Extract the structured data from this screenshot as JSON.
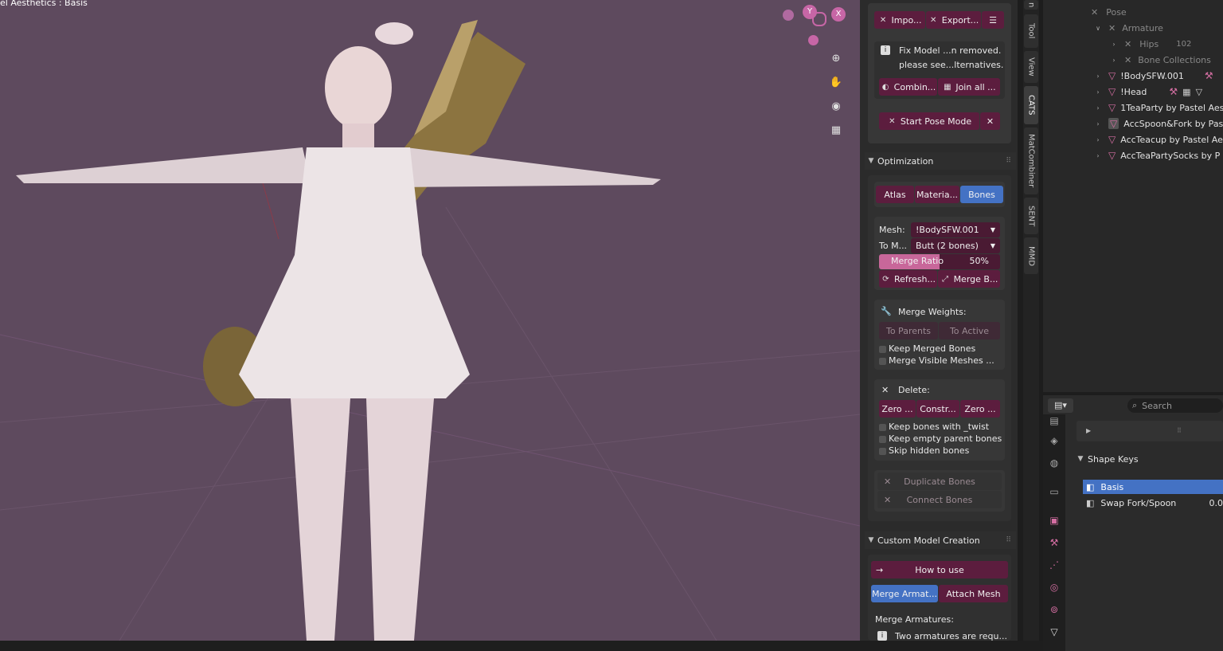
{
  "viewport": {
    "title": "el Aesthetics : Basis",
    "gizmo": {
      "y": "Y",
      "x": "X"
    },
    "icons": [
      "zoom-icon",
      "hand-icon",
      "camera-icon",
      "grid-icon"
    ]
  },
  "sidetabs": [
    "n",
    "Tool",
    "View",
    "CATS",
    "MatCombiner",
    "SENT",
    "MMD"
  ],
  "cats": {
    "import_label": "Impo...",
    "export_label": "Export...",
    "fix_model_line1": "Fix Model ...n removed.",
    "fix_model_line2": "please see...lternatives.",
    "combine_label": "Combin...",
    "join_label": "Join all ...",
    "start_pose_label": "Start Pose Mode"
  },
  "optimization": {
    "header": "Optimization",
    "tabs": [
      "Atlas",
      "Materia...",
      "Bones"
    ],
    "mesh_label": "Mesh:",
    "mesh_value": "!BodySFW.001",
    "to_merge_label": "To M...",
    "to_merge_value": "Butt (2 bones)",
    "merge_ratio_label": "Merge Ratio",
    "merge_ratio_value": "50%",
    "merge_ratio_fraction": 0.5,
    "refresh_label": "Refresh...",
    "merge_bones_label": "Merge B...",
    "merge_weights_label": "Merge Weights:",
    "to_parents_label": "To Parents",
    "to_active_label": "To Active",
    "keep_merged_label": "Keep Merged Bones",
    "merge_visible_label": "Merge Visible Meshes ...",
    "delete_label": "Delete:",
    "delete_buttons": [
      "Zero ...",
      "Constr...",
      "Zero ..."
    ],
    "keep_twist_label": "Keep bones with _twist",
    "keep_empty_label": "Keep empty parent bones",
    "skip_hidden_label": "Skip hidden bones",
    "duplicate_label": "Duplicate Bones",
    "connect_label": "Connect Bones"
  },
  "custom_model": {
    "header": "Custom Model Creation",
    "how_to_use_label": "How to use",
    "merge_armature_label": "Merge Armat...",
    "attach_mesh_label": "Attach Mesh",
    "merge_armatures_heading": "Merge Armatures:",
    "two_armatures_note": "Two armatures are requ..."
  },
  "outliner": {
    "rows": [
      {
        "label": "Pose",
        "dim": true
      },
      {
        "label": "Armature",
        "dim": true
      },
      {
        "label": "Hips",
        "dim": true,
        "count": "102"
      },
      {
        "label": "Bone Collections",
        "dim": true
      },
      {
        "label": "!BodySFW.001"
      },
      {
        "label": "!Head"
      },
      {
        "label": "1TeaParty by Pastel Aes"
      },
      {
        "label": "AccSpoon&Fork by Pas"
      },
      {
        "label": "AccTeacup by Pastel Ae"
      },
      {
        "label": "AccTeaPartySocks by P"
      }
    ]
  },
  "properties": {
    "search_placeholder": "Search",
    "shape_keys_header": "Shape Keys",
    "shape_keys": [
      {
        "name": "Basis",
        "value": ""
      },
      {
        "name": "Swap Fork/Spoon",
        "value": "0.0"
      }
    ]
  },
  "colors": {
    "viewport_bg": "#5e4a5e",
    "button_bg": "#5c1d3e",
    "active_blue": "#4472c4",
    "accent_pink": "#d46ea2"
  }
}
